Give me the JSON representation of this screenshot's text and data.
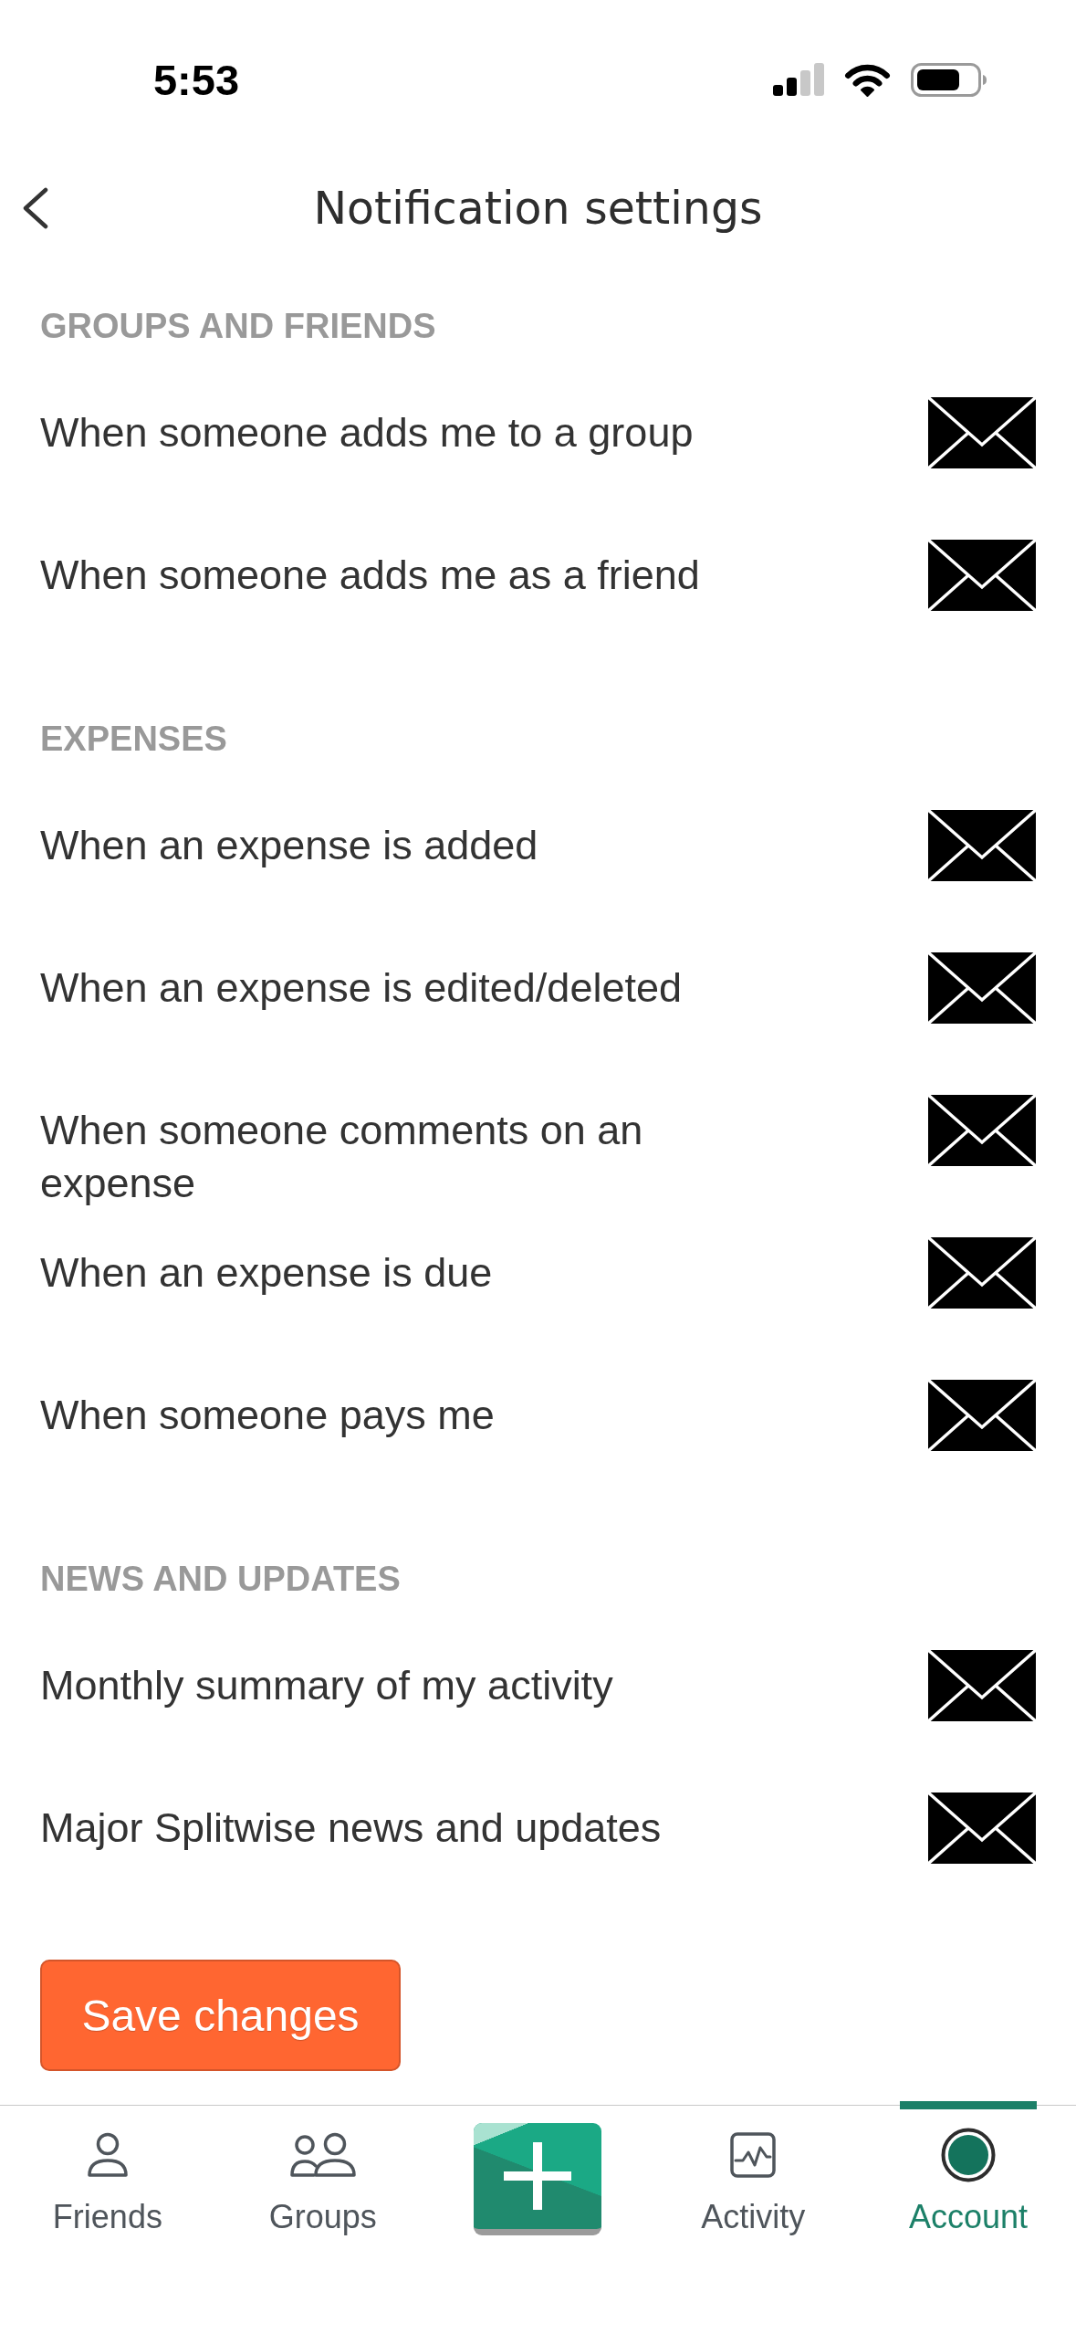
{
  "status_bar": {
    "time": "5:53"
  },
  "header": {
    "title": "Notification settings"
  },
  "sections": [
    {
      "heading": "GROUPS AND FRIENDS",
      "rows": [
        {
          "label": "When someone adds me to a group",
          "email": true
        },
        {
          "label": "When someone adds me as a friend",
          "email": true
        }
      ]
    },
    {
      "heading": "EXPENSES",
      "rows": [
        {
          "label": "When an expense is added",
          "email": true
        },
        {
          "label": "When an expense is edited/deleted",
          "email": true
        },
        {
          "label": "When someone comments on an expense",
          "email": true
        },
        {
          "label": "When an expense is due",
          "email": true
        },
        {
          "label": "When someone pays me",
          "email": true
        }
      ]
    },
    {
      "heading": "NEWS AND UPDATES",
      "rows": [
        {
          "label": "Monthly summary of my activity",
          "email": true
        },
        {
          "label": "Major Splitwise news and updates",
          "email": true
        }
      ]
    }
  ],
  "save_button": {
    "label": "Save changes"
  },
  "tab_bar": {
    "items": [
      {
        "kind": "tab",
        "label": "Friends",
        "selected": false
      },
      {
        "kind": "tab",
        "label": "Groups",
        "selected": false
      },
      {
        "kind": "add"
      },
      {
        "kind": "tab",
        "label": "Activity",
        "selected": false
      },
      {
        "kind": "tab",
        "label": "Account",
        "selected": true
      }
    ]
  }
}
